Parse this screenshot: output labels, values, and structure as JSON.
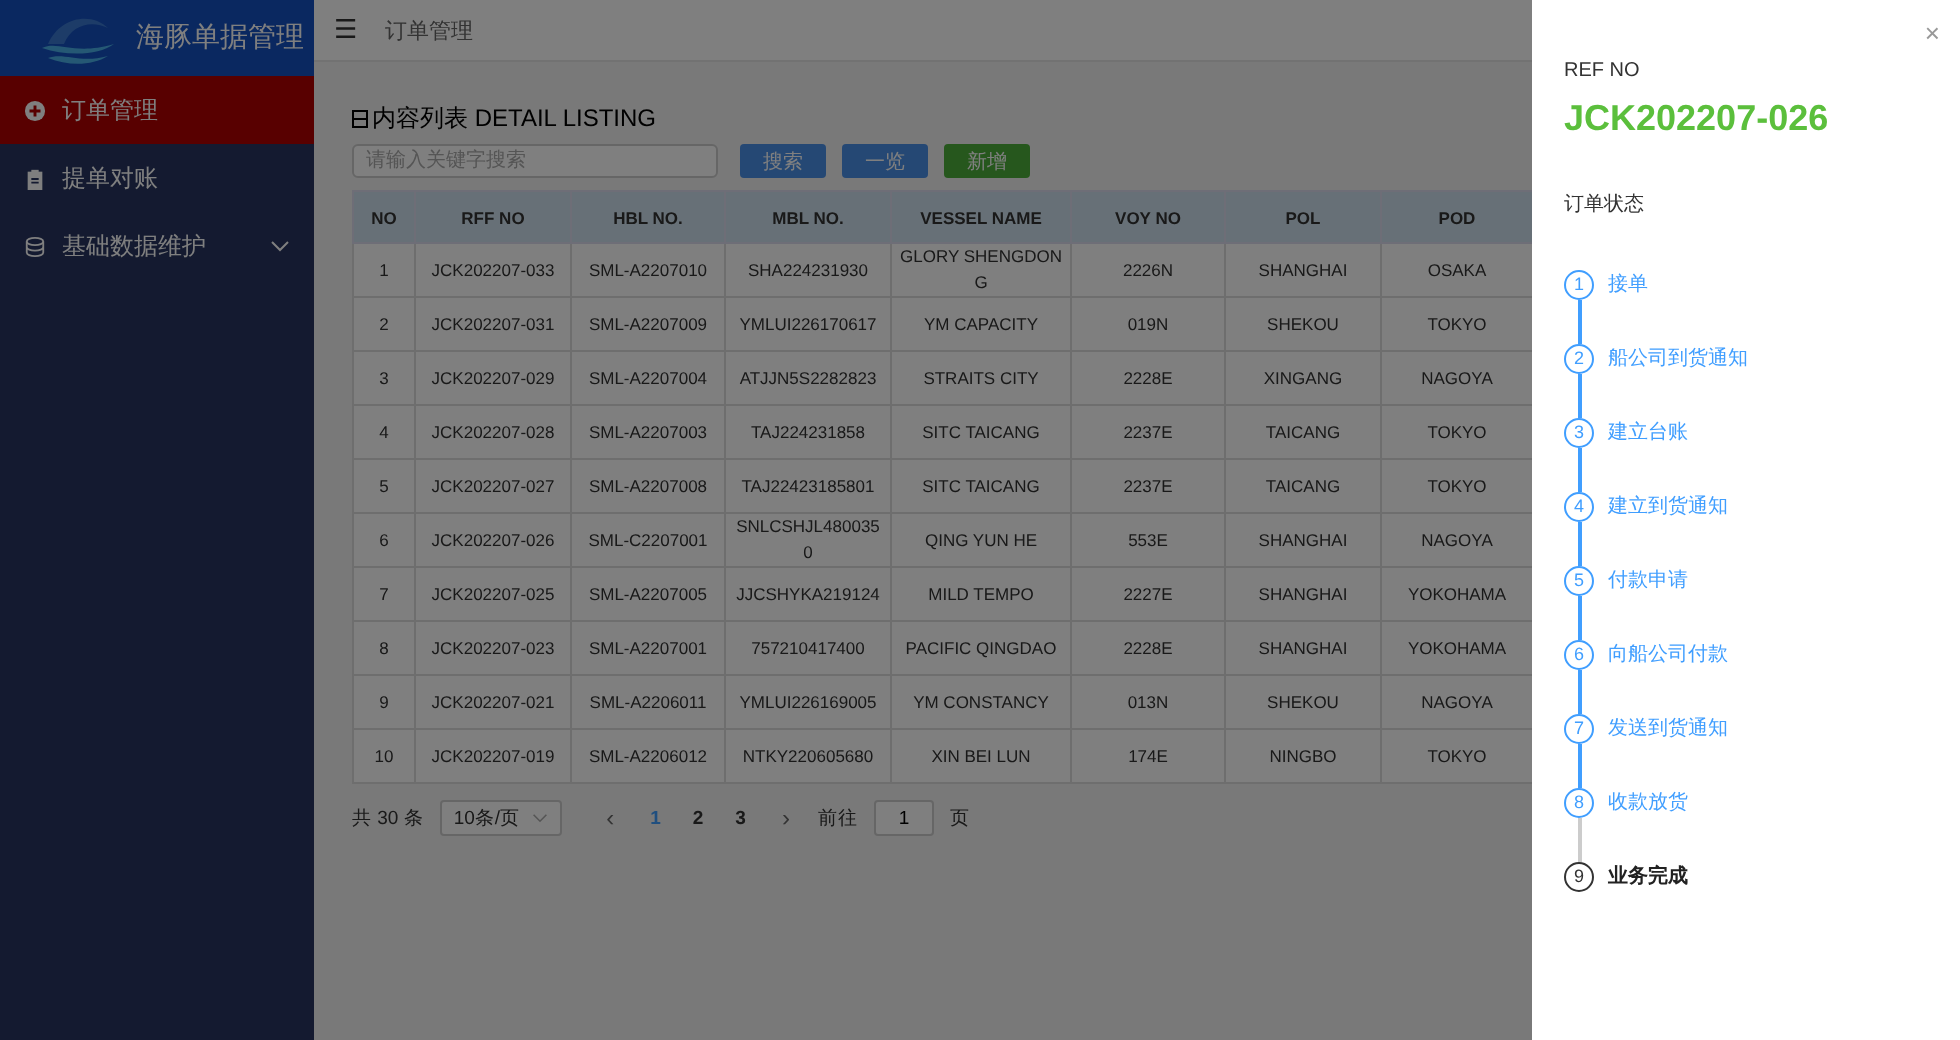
{
  "sidebar": {
    "app_title": "海豚单据管理",
    "items": [
      {
        "label": "订单管理",
        "selected": true,
        "kind": "plus",
        "expandable": false
      },
      {
        "label": "提单对账",
        "selected": false,
        "kind": "clipboard",
        "expandable": false
      },
      {
        "label": "基础数据维护",
        "selected": false,
        "kind": "database",
        "expandable": true
      }
    ]
  },
  "header": {
    "menu_icon": "☰",
    "breadcrumb": "订单管理"
  },
  "listing": {
    "title": "内容列表 DETAIL LISTING",
    "search": {
      "placeholder": "请输入关键字搜索"
    },
    "buttons": [
      {
        "label": "搜索",
        "kind": "primary"
      },
      {
        "label": "一览",
        "kind": "primary"
      },
      {
        "label": "新增",
        "kind": "success"
      }
    ],
    "table": {
      "columns": [
        "NO",
        "RFF NO",
        "HBL NO.",
        "MBL NO.",
        "VESSEL NAME",
        "VOY NO",
        "POL",
        "POD"
      ],
      "rows": [
        [
          "1",
          "JCK202207-033",
          "SML-A2207010",
          "SHA224231930",
          "GLORY SHENGDONG",
          "2226N",
          "SHANGHAI",
          "OSAKA"
        ],
        [
          "2",
          "JCK202207-031",
          "SML-A2207009",
          "YMLUI226170617",
          "YM CAPACITY",
          "019N",
          "SHEKOU",
          "TOKYO"
        ],
        [
          "3",
          "JCK202207-029",
          "SML-A2207004",
          "ATJJN5S2282823",
          "STRAITS CITY",
          "2228E",
          "XINGANG",
          "NAGOYA"
        ],
        [
          "4",
          "JCK202207-028",
          "SML-A2207003",
          "TAJ224231858",
          "SITC TAICANG",
          "2237E",
          "TAICANG",
          "TOKYO"
        ],
        [
          "5",
          "JCK202207-027",
          "SML-A2207008",
          "TAJ22423185801",
          "SITC TAICANG",
          "2237E",
          "TAICANG",
          "TOKYO"
        ],
        [
          "6",
          "JCK202207-026",
          "SML-C2207001",
          "SNLCSHJL4800350",
          "QING YUN HE",
          "553E",
          "SHANGHAI",
          "NAGOYA"
        ],
        [
          "7",
          "JCK202207-025",
          "SML-A2207005",
          "JJCSHYKA219124",
          "MILD TEMPO",
          "2227E",
          "SHANGHAI",
          "YOKOHAMA"
        ],
        [
          "8",
          "JCK202207-023",
          "SML-A2207001",
          "757210417400",
          "PACIFIC QINGDAO",
          "2228E",
          "SHANGHAI",
          "YOKOHAMA"
        ],
        [
          "9",
          "JCK202207-021",
          "SML-A2206011",
          "YMLUI226169005",
          "YM CONSTANCY",
          "013N",
          "SHEKOU",
          "NAGOYA"
        ],
        [
          "10",
          "JCK202207-019",
          "SML-A2206012",
          "NTKY220605680",
          "XIN BEI LUN",
          "174E",
          "NINGBO",
          "TOKYO"
        ]
      ]
    },
    "pagination": {
      "total": "共 30 条",
      "page_size": "10条/页",
      "prev": "‹",
      "pages": [
        {
          "label": "1",
          "selected": true
        },
        {
          "label": "2",
          "selected": false
        },
        {
          "label": "3",
          "selected": false
        }
      ],
      "next": "›",
      "goto_label": "前往",
      "goto_value": "1",
      "goto_suffix": "页"
    }
  },
  "drawer": {
    "close": "×",
    "ref_label": "REF NO",
    "ref_no": "JCK202207-026",
    "status_label": "订单状态",
    "steps": [
      {
        "number": "1",
        "label": "接单",
        "done": true
      },
      {
        "number": "2",
        "label": "船公司到货通知",
        "done": true
      },
      {
        "number": "3",
        "label": "建立台账",
        "done": true
      },
      {
        "number": "4",
        "label": "建立到货通知",
        "done": true
      },
      {
        "number": "5",
        "label": "付款申请",
        "done": true
      },
      {
        "number": "6",
        "label": "向船公司付款",
        "done": true
      },
      {
        "number": "7",
        "label": "发送到货通知",
        "done": true
      },
      {
        "number": "8",
        "label": "收款放货",
        "done": true
      },
      {
        "number": "9",
        "label": "业务完成",
        "done": false
      }
    ]
  }
}
